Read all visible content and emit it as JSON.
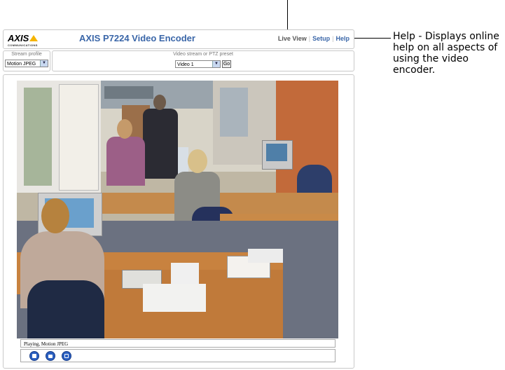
{
  "header": {
    "logo_text": "AXIS",
    "logo_subtext": "COMMUNICATIONS",
    "title": "AXIS P7224 Video Encoder",
    "nav": {
      "live_view": "Live View",
      "setup": "Setup",
      "help": "Help",
      "separator": "|"
    }
  },
  "controls": {
    "stream_profile_label": "Stream profile",
    "stream_profile_value": "Motion JPEG",
    "video_stream_label": "Video stream or PTZ preset",
    "video_stream_value": "Video 1",
    "go_label": "Go"
  },
  "status": {
    "text": "Playing, Motion JPEG"
  },
  "toolbar": {
    "buttons": [
      "stop-icon",
      "snapshot-icon",
      "fullscreen-icon"
    ]
  },
  "callout": {
    "text": "Help - Displays online help on all aspects of using the video encoder."
  },
  "colors": {
    "title_blue": "#3a66a8",
    "button_blue": "#2a5fc0",
    "logo_yellow": "#f5b400"
  }
}
